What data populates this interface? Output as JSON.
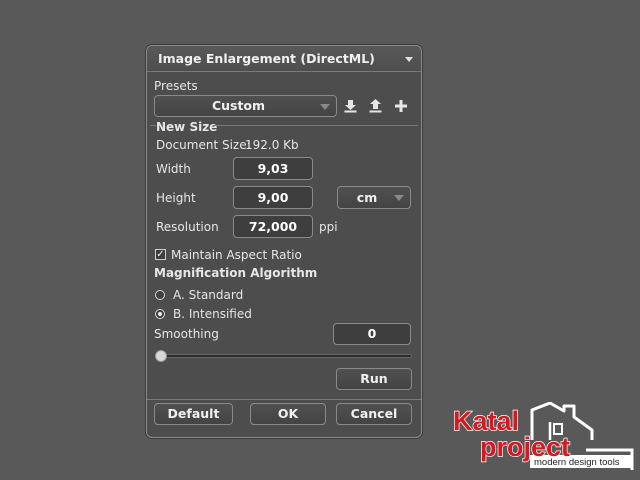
{
  "dialog": {
    "title": "Image Enlargement (DirectML)",
    "presets": {
      "label": "Presets",
      "selected": "Custom",
      "icons": [
        "save-preset-icon",
        "load-preset-icon",
        "add-preset-icon"
      ]
    },
    "new_size": {
      "section_title": "New Size",
      "document_size_label": "Document Size:",
      "document_size_value": "192.0 Kb",
      "width_label": "Width",
      "width_value": "9,03",
      "height_label": "Height",
      "height_value": "9,00",
      "unit_selected": "cm",
      "resolution_label": "Resolution",
      "resolution_value": "72,000",
      "resolution_unit": "ppi"
    },
    "maintain_aspect": {
      "label": "Maintain Aspect Ratio",
      "checked": true
    },
    "magnification": {
      "section_title": "Magnification Algorithm",
      "options": [
        {
          "label": "A. Standard",
          "selected": false
        },
        {
          "label": "B. Intensified",
          "selected": true
        }
      ]
    },
    "smoothing": {
      "label": "Smoothing",
      "value": "0",
      "slider_fraction": 0
    },
    "buttons": {
      "run": "Run",
      "default": "Default",
      "ok": "OK",
      "cancel": "Cancel"
    }
  },
  "logo": {
    "line1": "Katal",
    "line2": "project",
    "tagline": "modern design tools",
    "colors": {
      "red": "#d7191f",
      "white": "#ffffff"
    }
  }
}
